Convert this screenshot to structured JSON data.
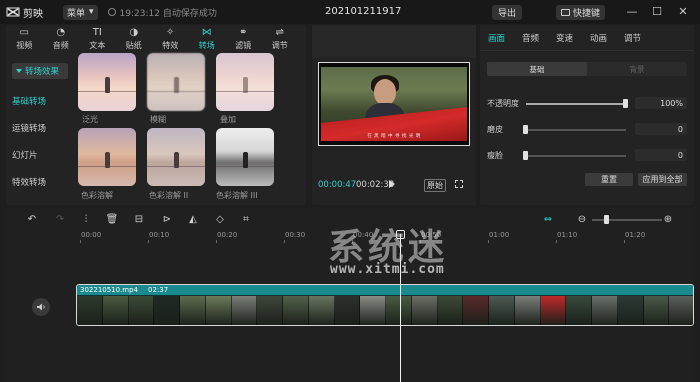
{
  "app": {
    "name": "剪映",
    "menu_label": "菜单",
    "autosave": "19:23:12 自动保存成功",
    "project_title": "202101211917",
    "export_label": "导出",
    "shortcut_label": "快捷键"
  },
  "categories": [
    {
      "label": "视频",
      "icon": "video-icon"
    },
    {
      "label": "音频",
      "icon": "audio-icon"
    },
    {
      "label": "文本",
      "icon": "text-icon"
    },
    {
      "label": "贴纸",
      "icon": "sticker-icon"
    },
    {
      "label": "特效",
      "icon": "effect-icon"
    },
    {
      "label": "转场",
      "icon": "transition-icon"
    },
    {
      "label": "滤镜",
      "icon": "filter-icon"
    },
    {
      "label": "调节",
      "icon": "adjust-icon"
    }
  ],
  "sidebar": {
    "header": "转场效果",
    "items": [
      "基础转场",
      "运镜转场",
      "幻灯片",
      "特效转场"
    ]
  },
  "transitions": [
    "泛光",
    "模糊",
    "叠加",
    "色彩溶解",
    "色彩溶解 II",
    "色彩溶解 III"
  ],
  "preview": {
    "current_time": "00:00:47",
    "duration": "00:02:38",
    "original_label": "原始",
    "subtitle": "在 黑 暗 中 寻 找 光 明 "
  },
  "properties": {
    "tabs": [
      "画面",
      "音频",
      "变速",
      "动画",
      "调节"
    ],
    "segments": [
      "基础",
      "背景"
    ],
    "opacity_label": "不透明度",
    "opacity_value": "100%",
    "opacity_level": 1.0,
    "smooth_label": "磨皮",
    "smooth_value": "0",
    "slim_label": "瘦脸",
    "slim_value": "0",
    "reset_label": "重置",
    "apply_all_label": "应用到全部"
  },
  "timeline": {
    "ruler": [
      "00:00",
      "00:10",
      "00:20",
      "00:30",
      "00:40",
      "00:50",
      "01:00",
      "01:10",
      "01:20"
    ],
    "clip_name": "302210510.mp4",
    "clip_duration": "02:37",
    "frame_colors": [
      "#2d3a2c",
      "#4b5a40",
      "#3c4b38",
      "#1f2a22",
      "#5d6b4c",
      "#6c7a5a",
      "#7b7f78",
      "#3f473b",
      "#52614a",
      "#687560",
      "#2b302c",
      "#8a8d86",
      "#4a5b43",
      "#6a7065",
      "#3c4a36",
      "#5b2a2a",
      "#4d5a55",
      "#7a7f7a",
      "#c02a2a",
      "#384a3c",
      "#6b706a",
      "#2c3a35",
      "#4a5a4a",
      "#5a605c"
    ]
  },
  "watermark": {
    "main": "系统迷",
    "sub": "www.xitmi.com"
  }
}
